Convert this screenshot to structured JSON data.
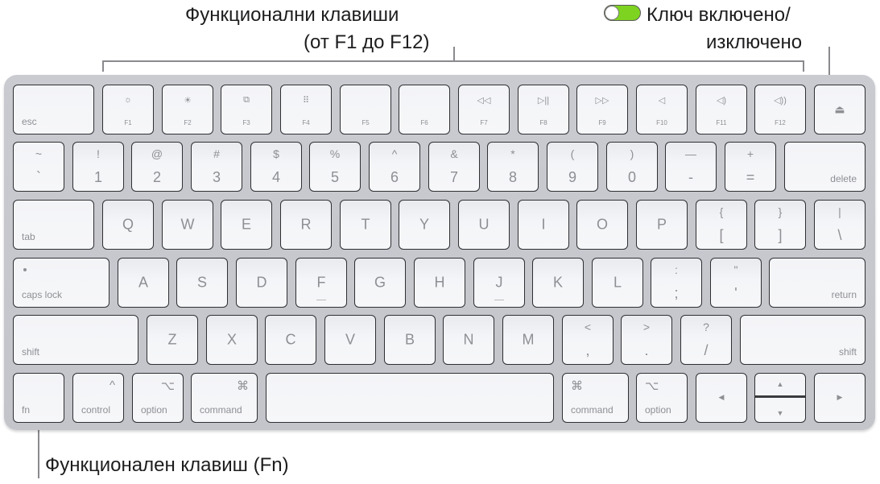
{
  "callouts": {
    "function_keys": {
      "line1": "Функционални клавиши",
      "line2": "(от F1 до F12)"
    },
    "power_switch": {
      "line1": "Ключ включено/",
      "line2": "изключено",
      "toggle_state": "on",
      "toggle_color": "#7ed321"
    },
    "fn_key": {
      "label": "Функционален клавиш (Fn)"
    }
  },
  "keyboard": {
    "row_fn": {
      "esc": "esc",
      "fkeys": [
        {
          "name": "F1",
          "icon": "brightness-down-icon",
          "glyph": "☼"
        },
        {
          "name": "F2",
          "icon": "brightness-up-icon",
          "glyph": "☀"
        },
        {
          "name": "F3",
          "icon": "mission-control-icon",
          "glyph": "⧉"
        },
        {
          "name": "F4",
          "icon": "launchpad-icon",
          "glyph": "⠿"
        },
        {
          "name": "F5",
          "icon": "",
          "glyph": ""
        },
        {
          "name": "F6",
          "icon": "",
          "glyph": ""
        },
        {
          "name": "F7",
          "icon": "rewind-icon",
          "glyph": "◁◁"
        },
        {
          "name": "F8",
          "icon": "play-pause-icon",
          "glyph": "▷||"
        },
        {
          "name": "F9",
          "icon": "fast-forward-icon",
          "glyph": "▷▷"
        },
        {
          "name": "F10",
          "icon": "mute-icon",
          "glyph": "◁"
        },
        {
          "name": "F11",
          "icon": "volume-down-icon",
          "glyph": "◁)"
        },
        {
          "name": "F12",
          "icon": "volume-up-icon",
          "glyph": "◁))"
        }
      ],
      "eject_glyph": "⏏"
    },
    "row_num": {
      "keys": [
        {
          "top": "~",
          "bottom": "`"
        },
        {
          "top": "!",
          "bottom": "1"
        },
        {
          "top": "@",
          "bottom": "2"
        },
        {
          "top": "#",
          "bottom": "3"
        },
        {
          "top": "$",
          "bottom": "4"
        },
        {
          "top": "%",
          "bottom": "5"
        },
        {
          "top": "^",
          "bottom": "6"
        },
        {
          "top": "&",
          "bottom": "7"
        },
        {
          "top": "*",
          "bottom": "8"
        },
        {
          "top": "(",
          "bottom": "9"
        },
        {
          "top": ")",
          "bottom": "0"
        },
        {
          "top": "—",
          "bottom": "-"
        },
        {
          "top": "+",
          "bottom": "="
        }
      ],
      "delete": "delete"
    },
    "row_q": {
      "tab": "tab",
      "letters": [
        "Q",
        "W",
        "E",
        "R",
        "T",
        "Y",
        "U",
        "I",
        "O",
        "P"
      ],
      "sym": [
        {
          "top": "{",
          "bottom": "["
        },
        {
          "top": "}",
          "bottom": "]"
        },
        {
          "top": "|",
          "bottom": "\\"
        }
      ]
    },
    "row_a": {
      "caps": "caps lock",
      "letters": [
        "A",
        "S",
        "D",
        "F",
        "G",
        "H",
        "J",
        "K",
        "L"
      ],
      "sym": [
        {
          "top": ":",
          "bottom": ";"
        },
        {
          "top": "\"",
          "bottom": "'"
        }
      ],
      "return": "return"
    },
    "row_z": {
      "shift_left": "shift",
      "letters": [
        "Z",
        "X",
        "C",
        "V",
        "B",
        "N",
        "M"
      ],
      "sym": [
        {
          "top": "<",
          "bottom": ","
        },
        {
          "top": ">",
          "bottom": "."
        },
        {
          "top": "?",
          "bottom": "/"
        }
      ],
      "shift_right": "shift"
    },
    "row_bottom": {
      "fn": "fn",
      "control": "control",
      "control_glyph": "^",
      "option": "option",
      "option_glyph": "⌥",
      "command": "command",
      "command_glyph": "⌘",
      "arrow_left": "◀",
      "arrow_up": "▲",
      "arrow_down": "▼",
      "arrow_right": "▶"
    }
  }
}
